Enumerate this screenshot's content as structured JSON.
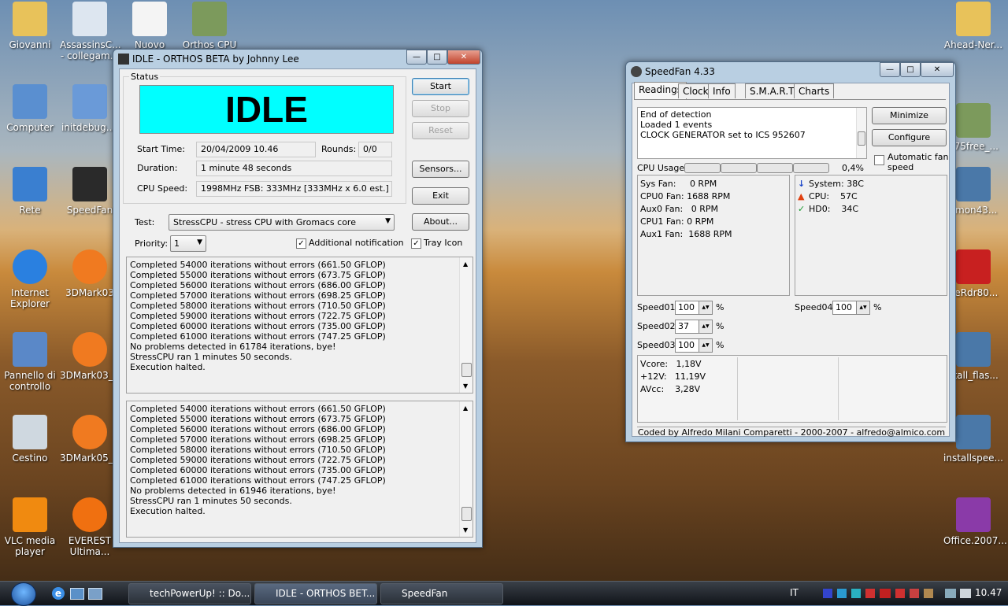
{
  "desktop": {
    "left_icons": [
      {
        "label": "Giovanni",
        "icon": "folder-icon"
      },
      {
        "label": "AssassinsC... - collegam...",
        "icon": "shortcut-icon"
      },
      {
        "label": "Nuovo",
        "icon": "document-icon"
      },
      {
        "label": "Orthos CPU",
        "icon": "app-icon"
      },
      {
        "label": "Computer",
        "icon": "computer-icon"
      },
      {
        "label": "initdebug....",
        "icon": "info-icon"
      },
      {
        "label": "Rete",
        "icon": "network-icon"
      },
      {
        "label": "SpeedFan",
        "icon": "fan-icon"
      },
      {
        "label": "Internet Explorer",
        "icon": "ie-icon"
      },
      {
        "label": "3DMark03",
        "icon": "3dmark-icon"
      },
      {
        "label": "Pannello di controllo",
        "icon": "control-panel-icon"
      },
      {
        "label": "3DMark03_...",
        "icon": "3dmark-icon"
      },
      {
        "label": "Cestino",
        "icon": "recycle-bin-icon"
      },
      {
        "label": "3DMark05_...",
        "icon": "3dmark-icon"
      },
      {
        "label": "VLC media player",
        "icon": "vlc-icon"
      },
      {
        "label": "EVEREST Ultima...",
        "icon": "everest-icon"
      }
    ],
    "right_icons": [
      {
        "label": "Ahead-Ner...",
        "icon": "folder-icon"
      },
      {
        "label": "g75free_...",
        "icon": "app-icon"
      },
      {
        "label": "emon43...",
        "icon": "installer-icon"
      },
      {
        "label": "beRdr80...",
        "icon": "pdf-icon"
      },
      {
        "label": "stall_flas...",
        "icon": "installer-icon"
      },
      {
        "label": "installspee...",
        "icon": "installer-icon"
      },
      {
        "label": "Office.2007...",
        "icon": "archive-icon"
      }
    ]
  },
  "orthos": {
    "title": "IDLE - ORTHOS BETA by Johnny Lee",
    "status_label": "Status",
    "status_text": "IDLE",
    "status_color": "#00ffff",
    "start_time_label": "Start Time:",
    "start_time": "20/04/2009 10.46",
    "rounds_label": "Rounds:",
    "rounds": "0/0",
    "duration_label": "Duration:",
    "duration": "1 minute 48 seconds",
    "cpu_speed_label": "CPU Speed:",
    "cpu_speed": "1998MHz FSB: 333MHz [333MHz x 6.0 est.]",
    "buttons": {
      "start": "Start",
      "stop": "Stop",
      "reset": "Reset",
      "sensors": "Sensors...",
      "exit": "Exit",
      "about": "About..."
    },
    "test_label": "Test:",
    "test_value": "StressCPU - stress CPU with Gromacs core",
    "priority_label": "Priority:",
    "priority_value": "1",
    "additional_notification": "Additional notification",
    "tray_icon": "Tray Icon",
    "log1": [
      "Completed 54000 iterations without errors (661.50 GFLOP)",
      "Completed 55000 iterations without errors (673.75 GFLOP)",
      "Completed 56000 iterations without errors (686.00 GFLOP)",
      "Completed 57000 iterations without errors (698.25 GFLOP)",
      "Completed 58000 iterations without errors (710.50 GFLOP)",
      "Completed 59000 iterations without errors (722.75 GFLOP)",
      "Completed 60000 iterations without errors (735.00 GFLOP)",
      "Completed 61000 iterations without errors (747.25 GFLOP)",
      "No problems detected in 61784 iterations, bye!",
      "StressCPU ran 1 minutes 50 seconds.",
      "Execution halted."
    ],
    "log2": [
      "Completed 54000 iterations without errors (661.50 GFLOP)",
      "Completed 55000 iterations without errors (673.75 GFLOP)",
      "Completed 56000 iterations without errors (686.00 GFLOP)",
      "Completed 57000 iterations without errors (698.25 GFLOP)",
      "Completed 58000 iterations without errors (710.50 GFLOP)",
      "Completed 59000 iterations without errors (722.75 GFLOP)",
      "Completed 60000 iterations without errors (735.00 GFLOP)",
      "Completed 61000 iterations without errors (747.25 GFLOP)",
      "No problems detected in 61946 iterations, bye!",
      "StressCPU ran 1 minutes 50 seconds.",
      "Execution halted."
    ]
  },
  "speedfan": {
    "title": "SpeedFan 4.33",
    "tabs": [
      "Readings",
      "Clock",
      "Info",
      "S.M.A.R.T.",
      "Charts"
    ],
    "log": [
      "End of detection",
      "Loaded 1 events",
      "CLOCK GENERATOR set to ICS 952607"
    ],
    "minimize": "Minimize",
    "configure": "Configure",
    "auto_fan": "Automatic fan speed",
    "cpu_usage_label": "CPU Usage",
    "cpu_usage_value": "0,4%",
    "fans": [
      "Sys Fan:     0 RPM",
      "CPU0 Fan: 1688 RPM",
      "Aux0 Fan:   0 RPM",
      "CPU1 Fan: 0 RPM",
      "Aux1 Fan:  1688 RPM"
    ],
    "temps": [
      {
        "icon": "arrow-down-icon",
        "text": "System: 38C"
      },
      {
        "icon": "flame-icon",
        "text": "CPU:    57C"
      },
      {
        "icon": "check-icon",
        "text": "HD0:    34C"
      }
    ],
    "speeds": [
      {
        "label": "Speed01:",
        "value": "100",
        "unit": "%"
      },
      {
        "label": "Speed02:",
        "value": "37",
        "unit": "%"
      },
      {
        "label": "Speed03:",
        "value": "100",
        "unit": "%"
      },
      {
        "label": "Speed04:",
        "value": "100",
        "unit": "%"
      }
    ],
    "voltages": [
      "Vcore:   1,18V",
      "+12V:   11,19V",
      "AVcc:    3,28V"
    ],
    "footer": "Coded by Alfredo Milani Comparetti - 2000-2007 - alfredo@almico.com"
  },
  "taskbar": {
    "tasks": [
      "techPowerUp! :: Do...",
      "IDLE - ORTHOS BET...",
      "SpeedFan"
    ],
    "language": "IT",
    "clock": "10.47"
  }
}
